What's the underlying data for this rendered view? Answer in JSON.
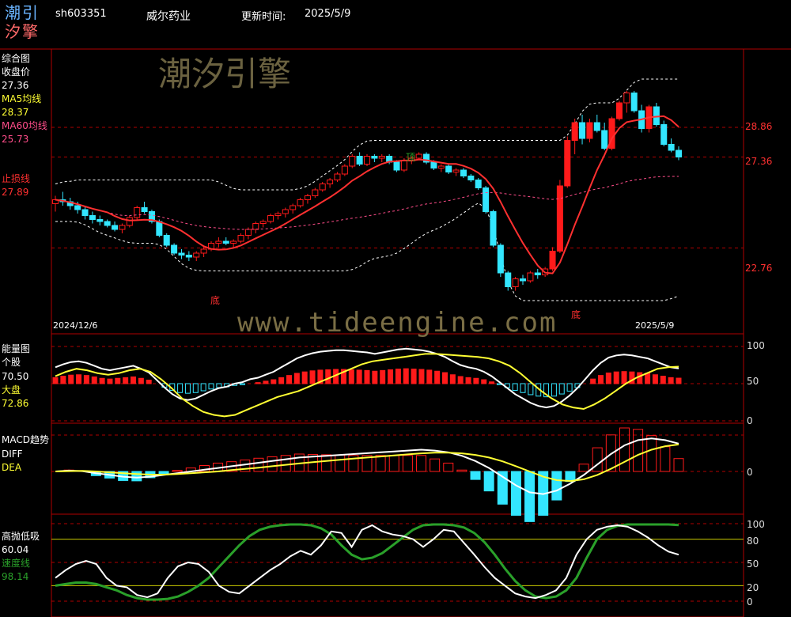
{
  "header": {
    "logo_top": "潮引",
    "logo_bottom": "汐擎",
    "code": "sh603351",
    "name": "威尔药业",
    "update_label": "更新时间:",
    "update_date": "2025/5/9"
  },
  "watermark": {
    "brand": "潮汐引擎",
    "url": "www.tideengine.com"
  },
  "colors": {
    "up": "#ff1a1a",
    "down": "#33e6ff",
    "ma5": "#ffff33",
    "ma60": "#ff4d8a",
    "stop": "#ff3030",
    "axis_red": "#cc0000",
    "green": "#2aa02a"
  },
  "main": {
    "title": "综合图",
    "close_label": "收盘价",
    "close_value": "27.36",
    "ma5_label": "MA5均线",
    "ma5_value": "28.37",
    "ma60_label": "MA60均线",
    "ma60_value": "25.73",
    "stop_label": "止损线",
    "stop_value": "27.89",
    "y_ticks": [
      "28.86",
      "27.36",
      "22.76"
    ],
    "date_start": "2024/12/6",
    "date_end": "2025/5/9",
    "marks": [
      "顶",
      "底",
      "底"
    ]
  },
  "energy": {
    "title": "能量图",
    "stock_label": "个股",
    "stock_value": "70.50",
    "market_label": "大盘",
    "market_value": "72.86",
    "y_ticks": [
      "100",
      "50",
      "0"
    ]
  },
  "macd": {
    "title": "MACD趋势",
    "diff_label": "DIFF",
    "dea_label": "DEA",
    "y_ticks": [
      "0"
    ]
  },
  "hilo": {
    "title": "高抛低吸",
    "value": "60.04",
    "speed_label": "速度线",
    "speed_value": "98.14",
    "y_ticks": [
      "100",
      "80",
      "50",
      "20",
      "0"
    ]
  },
  "chart_data": {
    "type": "candlestick",
    "n": 98,
    "candles": [
      [
        25.0,
        25.4,
        24.6,
        25.2
      ],
      [
        25.2,
        25.6,
        24.9,
        25.1
      ],
      [
        25.1,
        25.3,
        24.7,
        24.9
      ],
      [
        24.9,
        25.1,
        24.5,
        24.7
      ],
      [
        24.7,
        24.9,
        24.2,
        24.4
      ],
      [
        24.4,
        24.6,
        24.0,
        24.2
      ],
      [
        24.2,
        24.4,
        23.9,
        24.1
      ],
      [
        24.1,
        24.2,
        23.8,
        23.9
      ],
      [
        23.9,
        24.1,
        23.6,
        23.7
      ],
      [
        23.7,
        24.0,
        23.5,
        23.9
      ],
      [
        23.9,
        24.4,
        23.8,
        24.3
      ],
      [
        24.3,
        24.9,
        24.2,
        24.8
      ],
      [
        24.8,
        25.1,
        24.5,
        24.6
      ],
      [
        24.6,
        24.7,
        24.0,
        24.1
      ],
      [
        24.1,
        24.2,
        23.3,
        23.4
      ],
      [
        23.4,
        23.5,
        22.8,
        22.9
      ],
      [
        22.9,
        23.0,
        22.4,
        22.5
      ],
      [
        22.5,
        22.7,
        22.2,
        22.4
      ],
      [
        22.4,
        22.6,
        22.1,
        22.3
      ],
      [
        22.3,
        22.6,
        22.1,
        22.5
      ],
      [
        22.5,
        22.8,
        22.3,
        22.7
      ],
      [
        22.7,
        23.1,
        22.6,
        23.0
      ],
      [
        23.0,
        23.3,
        22.8,
        23.1
      ],
      [
        23.1,
        23.3,
        22.9,
        23.0
      ],
      [
        23.0,
        23.2,
        22.8,
        23.1
      ],
      [
        23.1,
        23.5,
        23.0,
        23.4
      ],
      [
        23.4,
        23.8,
        23.2,
        23.7
      ],
      [
        23.7,
        24.1,
        23.5,
        24.0
      ],
      [
        24.0,
        24.2,
        23.8,
        24.1
      ],
      [
        24.1,
        24.5,
        24.0,
        24.4
      ],
      [
        24.4,
        24.6,
        24.2,
        24.5
      ],
      [
        24.5,
        24.8,
        24.3,
        24.7
      ],
      [
        24.7,
        25.0,
        24.5,
        24.9
      ],
      [
        24.9,
        25.3,
        24.8,
        25.2
      ],
      [
        25.2,
        25.5,
        25.0,
        25.4
      ],
      [
        25.4,
        25.8,
        25.3,
        25.7
      ],
      [
        25.7,
        26.1,
        25.6,
        26.0
      ],
      [
        26.0,
        26.3,
        25.8,
        26.2
      ],
      [
        26.2,
        26.6,
        26.1,
        26.5
      ],
      [
        26.5,
        27.0,
        26.4,
        26.9
      ],
      [
        26.9,
        27.5,
        26.8,
        27.4
      ],
      [
        27.4,
        27.6,
        26.9,
        27.0
      ],
      [
        27.0,
        27.5,
        26.9,
        27.4
      ],
      [
        27.4,
        27.5,
        27.1,
        27.3
      ],
      [
        27.3,
        27.5,
        27.1,
        27.4
      ],
      [
        27.4,
        27.5,
        27.0,
        27.1
      ],
      [
        27.1,
        27.2,
        26.6,
        26.7
      ],
      [
        26.7,
        27.3,
        26.6,
        27.2
      ],
      [
        27.2,
        27.4,
        27.0,
        27.3
      ],
      [
        27.3,
        27.6,
        27.2,
        27.5
      ],
      [
        27.5,
        27.6,
        27.0,
        27.1
      ],
      [
        27.1,
        27.2,
        26.7,
        26.8
      ],
      [
        26.8,
        27.0,
        26.6,
        26.9
      ],
      [
        26.9,
        27.0,
        26.5,
        26.6
      ],
      [
        26.6,
        26.8,
        26.4,
        26.7
      ],
      [
        26.7,
        26.8,
        26.3,
        26.4
      ],
      [
        26.4,
        26.5,
        26.1,
        26.2
      ],
      [
        26.2,
        26.3,
        25.7,
        25.8
      ],
      [
        25.8,
        25.9,
        24.5,
        24.6
      ],
      [
        24.6,
        24.7,
        22.8,
        22.9
      ],
      [
        22.9,
        23.0,
        21.3,
        21.5
      ],
      [
        21.5,
        21.6,
        20.6,
        20.8
      ],
      [
        20.8,
        21.3,
        20.6,
        21.2
      ],
      [
        21.2,
        21.4,
        20.9,
        21.1
      ],
      [
        21.1,
        21.6,
        21.0,
        21.5
      ],
      [
        21.5,
        21.7,
        21.2,
        21.4
      ],
      [
        21.4,
        21.8,
        21.3,
        21.7
      ],
      [
        21.7,
        22.8,
        21.6,
        22.6
      ],
      [
        22.6,
        26.2,
        22.5,
        25.9
      ],
      [
        25.9,
        28.4,
        25.8,
        28.2
      ],
      [
        28.2,
        29.3,
        27.5,
        29.1
      ],
      [
        29.1,
        29.5,
        28.0,
        28.3
      ],
      [
        28.3,
        29.3,
        28.1,
        29.1
      ],
      [
        29.1,
        29.5,
        28.6,
        28.7
      ],
      [
        28.7,
        29.1,
        27.7,
        27.8
      ],
      [
        27.8,
        29.4,
        27.7,
        29.3
      ],
      [
        29.3,
        30.2,
        29.2,
        30.1
      ],
      [
        30.1,
        30.7,
        29.6,
        30.6
      ],
      [
        30.6,
        30.7,
        29.6,
        29.7
      ],
      [
        29.7,
        30.0,
        28.6,
        28.8
      ],
      [
        28.8,
        30.0,
        28.6,
        29.9
      ],
      [
        29.9,
        30.1,
        28.9,
        29.0
      ],
      [
        29.0,
        29.2,
        27.9,
        28.0
      ],
      [
        28.0,
        28.3,
        27.6,
        27.7
      ],
      [
        27.7,
        27.9,
        27.2,
        27.36
      ]
    ],
    "energy_stock": [
      72,
      76,
      79,
      80,
      78,
      74,
      70,
      68,
      70,
      72,
      74,
      70,
      65,
      55,
      45,
      36,
      30,
      28,
      30,
      35,
      40,
      44,
      46,
      50,
      52,
      56,
      58,
      62,
      66,
      72,
      78,
      84,
      88,
      91,
      93,
      94,
      95,
      95,
      94,
      93,
      92,
      90,
      92,
      94,
      96,
      97,
      96,
      95,
      93,
      90,
      86,
      80,
      75,
      72,
      70,
      66,
      60,
      52,
      44,
      36,
      30,
      24,
      20,
      18,
      20,
      26,
      34,
      44,
      56,
      68,
      78,
      85,
      88,
      89,
      88,
      86,
      84,
      80,
      76,
      72,
      70.5
    ],
    "energy_market": [
      60,
      66,
      70,
      68,
      64,
      62,
      64,
      68,
      70,
      66,
      56,
      44,
      30,
      20,
      12,
      8,
      6,
      8,
      14,
      20,
      26,
      32,
      36,
      40,
      46,
      52,
      58,
      64,
      70,
      76,
      80,
      82,
      84,
      86,
      88,
      90,
      90,
      89,
      88,
      87,
      86,
      84,
      80,
      74,
      64,
      52,
      40,
      30,
      22,
      18,
      16,
      22,
      30,
      40,
      50,
      58,
      64,
      70,
      72,
      72.86
    ],
    "diff": [
      0,
      0.05,
      0.02,
      -0.1,
      -0.2,
      -0.3,
      -0.35,
      -0.3,
      -0.2,
      -0.1,
      0,
      0.1,
      0.2,
      0.3,
      0.4,
      0.5,
      0.6,
      0.7,
      0.8,
      0.85,
      0.9,
      0.95,
      1.0,
      1.05,
      1.1,
      1.15,
      1.2,
      1.25,
      1.2,
      1.1,
      0.9,
      0.6,
      0.2,
      -0.3,
      -0.8,
      -1.2,
      -1.3,
      -1.1,
      -0.7,
      -0.2,
      0.4,
      1.0,
      1.5,
      1.8,
      1.9,
      1.8,
      1.6
    ],
    "dea": [
      0,
      0.02,
      0.03,
      0,
      -0.05,
      -0.1,
      -0.15,
      -0.18,
      -0.18,
      -0.15,
      -0.1,
      -0.05,
      0,
      0.08,
      0.15,
      0.22,
      0.3,
      0.38,
      0.46,
      0.53,
      0.6,
      0.67,
      0.74,
      0.8,
      0.86,
      0.92,
      0.98,
      1.04,
      1.08,
      1.08,
      1.04,
      0.95,
      0.8,
      0.58,
      0.3,
      0,
      -0.3,
      -0.5,
      -0.55,
      -0.45,
      -0.2,
      0.15,
      0.55,
      0.95,
      1.25,
      1.45,
      1.55
    ],
    "hilo": [
      30,
      40,
      48,
      52,
      48,
      30,
      20,
      18,
      8,
      5,
      10,
      30,
      45,
      50,
      48,
      38,
      20,
      12,
      10,
      20,
      30,
      40,
      48,
      58,
      65,
      60,
      72,
      90,
      88,
      70,
      92,
      98,
      90,
      86,
      84,
      80,
      70,
      80,
      92,
      90,
      75,
      60,
      44,
      30,
      20,
      10,
      6,
      4,
      8,
      14,
      30,
      60,
      80,
      92,
      96,
      98,
      96,
      90,
      82,
      72,
      64,
      60.04
    ],
    "speed": [
      20,
      22,
      24,
      24,
      22,
      18,
      14,
      8,
      4,
      2,
      2,
      3,
      6,
      12,
      20,
      30,
      44,
      58,
      72,
      84,
      92,
      96,
      98,
      99,
      99,
      98,
      94,
      86,
      72,
      60,
      54,
      56,
      62,
      72,
      82,
      92,
      98,
      99,
      99,
      98,
      95,
      88,
      76,
      60,
      42,
      26,
      14,
      6,
      4,
      6,
      14,
      30,
      56,
      80,
      92,
      97,
      99,
      99,
      99,
      99,
      99,
      98.14
    ]
  }
}
